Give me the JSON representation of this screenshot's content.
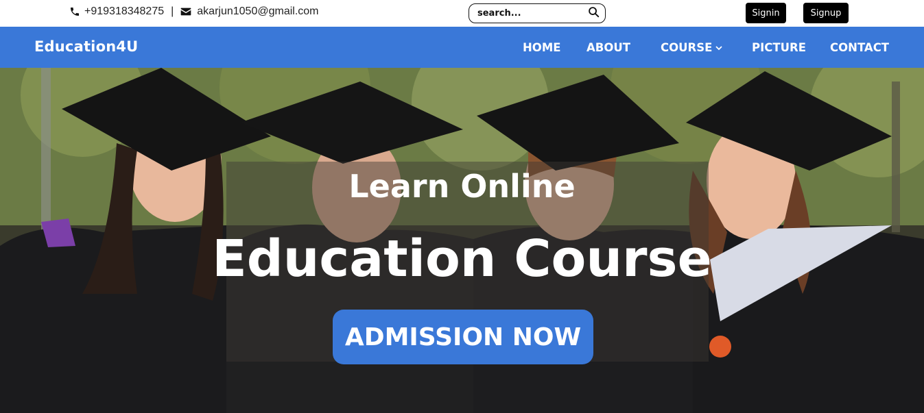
{
  "topbar": {
    "phone": "+919318348275",
    "separator": "|",
    "email": "akarjun1050@gmail.com",
    "search_placeholder": "search...",
    "signin_label": "Signin",
    "signup_label": "Signup"
  },
  "nav": {
    "brand": "Education4U",
    "items": [
      {
        "label": "HOME"
      },
      {
        "label": "ABOUT"
      },
      {
        "label": "COURSE"
      },
      {
        "label": "PICTURE"
      },
      {
        "label": "CONTACT"
      }
    ]
  },
  "hero": {
    "subtitle": "Learn Online",
    "title": "Education Course",
    "cta_label": "ADMISSION NOW"
  },
  "colors": {
    "primary": "#3a78d8",
    "button_dark": "#000000",
    "text_light": "#ffffff"
  },
  "icons": [
    "phone-icon",
    "envelope-icon",
    "search-icon",
    "chevron-down-icon"
  ]
}
